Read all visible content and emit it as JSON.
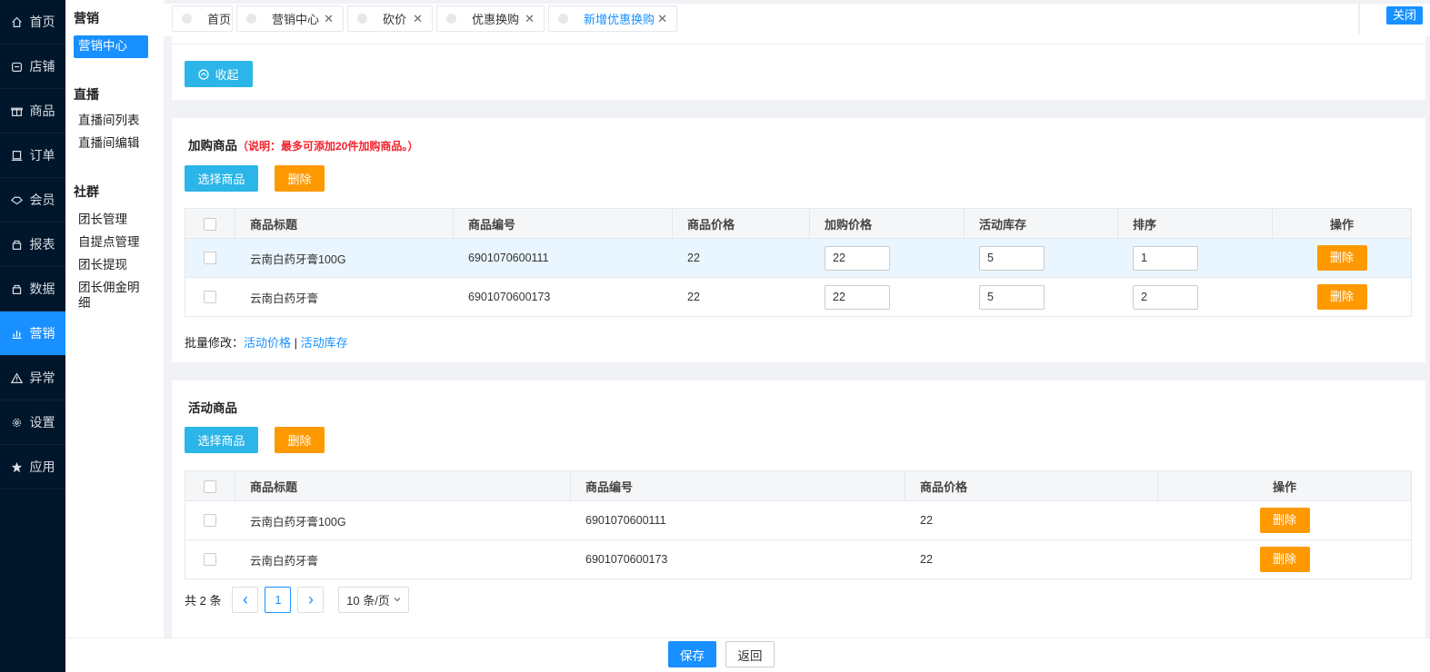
{
  "leftnav": {
    "items": [
      {
        "label": "首页",
        "icon": "home-icon"
      },
      {
        "label": "店铺",
        "icon": "store-icon"
      },
      {
        "label": "商品",
        "icon": "gift-icon"
      },
      {
        "label": "订单",
        "icon": "order-icon"
      },
      {
        "label": "会员",
        "icon": "member-icon"
      },
      {
        "label": "报表",
        "icon": "report-icon"
      },
      {
        "label": "数据",
        "icon": "data-icon"
      },
      {
        "label": "营销",
        "icon": "chart-icon",
        "active": true
      },
      {
        "label": "异常",
        "icon": "warning-icon"
      },
      {
        "label": "设置",
        "icon": "gear-icon"
      },
      {
        "label": "应用",
        "icon": "star-icon"
      }
    ],
    "active_color": "#1890ff"
  },
  "subnav": {
    "group1": "营销",
    "item_marketing_center": "营销中心",
    "group2": "直播",
    "live_list": "直播间列表",
    "live_edit": "直播间编辑",
    "group3": "社群",
    "leader_manage": "团长管理",
    "pickup_manage": "自提点管理",
    "leader_withdraw": "团长提现",
    "leader_commission": "团长佣金明细"
  },
  "tabs": {
    "home": "首页",
    "marketing_center": "营销中心",
    "bargain": "砍价",
    "discount_swap": "优惠换购",
    "new_discount_swap": "新增优惠换购",
    "close_all": "关闭"
  },
  "top_card": {
    "collapse_label": "收起"
  },
  "addon_section": {
    "title": "加购商品",
    "note": "（说明：最多可添加20件加购商品。）",
    "select_btn": "选择商品",
    "delete_btn": "删除",
    "headers": [
      "商品标题",
      "商品编号",
      "商品价格",
      "加购价格",
      "活动库存",
      "排序",
      "操作"
    ],
    "rows": [
      {
        "title": "云南白药牙膏100G",
        "code": "6901070600111",
        "price": "22",
        "addon_price": "22",
        "stock": "5",
        "sort": "1",
        "action": "删除"
      },
      {
        "title": "云南白药牙膏",
        "code": "6901070600173",
        "price": "22",
        "addon_price": "22",
        "stock": "5",
        "sort": "2",
        "action": "删除"
      }
    ],
    "batch_label": "批量修改：",
    "batch_price": "活动价格",
    "batch_sep": "|",
    "batch_stock": "活动库存"
  },
  "activity_section": {
    "title": "活动商品",
    "select_btn": "选择商品",
    "delete_btn": "删除",
    "headers": [
      "商品标题",
      "商品编号",
      "商品价格",
      "操作"
    ],
    "rows": [
      {
        "title": "云南白药牙膏100G",
        "code": "6901070600111",
        "price": "22",
        "action": "删除"
      },
      {
        "title": "云南白药牙膏",
        "code": "6901070600173",
        "price": "22",
        "action": "删除"
      }
    ],
    "pager": {
      "total": "共 2 条",
      "prev": "‹",
      "page": "1",
      "next": "›",
      "page_size": "10 条/页"
    }
  },
  "footer": {
    "save": "保存",
    "back": "返回"
  },
  "colors": {
    "primary": "#1890ff",
    "cyan": "#2bb5e8",
    "orange": "#ff9900",
    "danger": "#f5222d"
  }
}
